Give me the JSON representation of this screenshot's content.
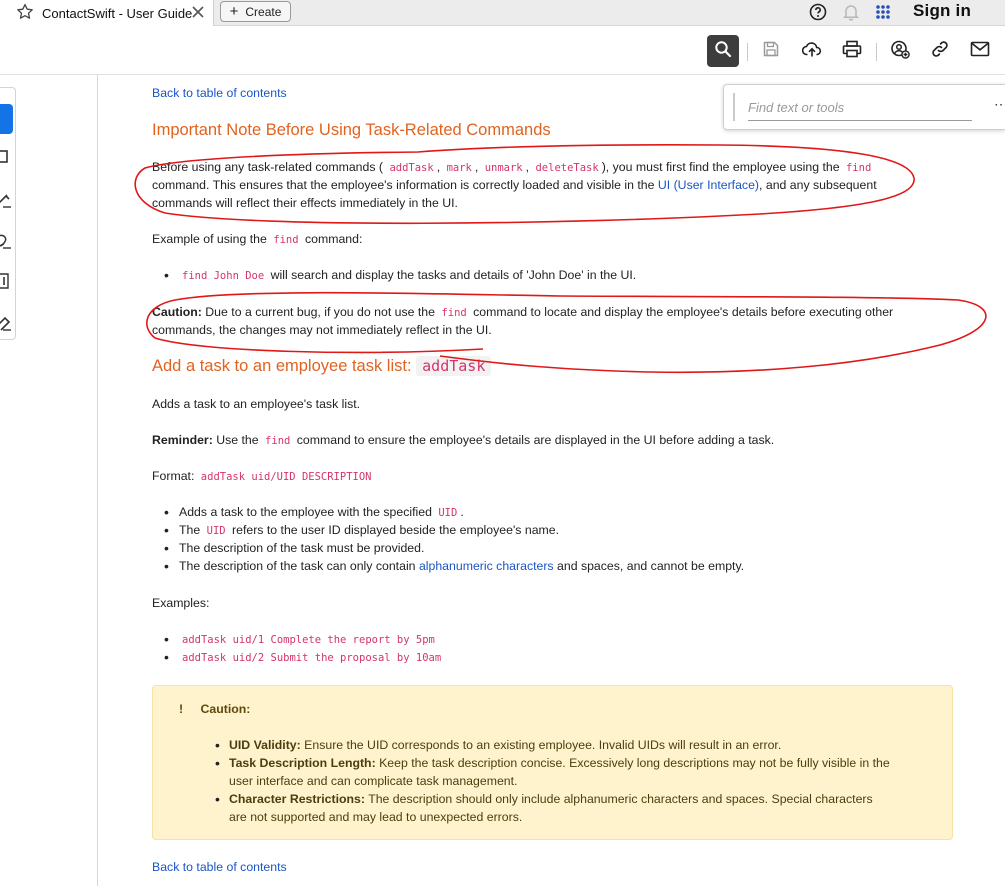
{
  "browser": {
    "tab_title": "ContactSwift - User Guide",
    "create_label": "Create",
    "signin_label": "Sign in"
  },
  "find": {
    "placeholder": "Find text or tools"
  },
  "doc": {
    "back_link_top": "Back to table of contents",
    "heading1": "Important Note Before Using Task-Related Commands",
    "para1": {
      "pre": "Before using any task-related commands (",
      "c1": "addTask",
      "sep1": ",",
      "c2": "mark",
      "sep2": ",",
      "c3": "unmark",
      "sep3": ",",
      "c4": "deleteTask",
      "mid": "), you must first find the employee using the",
      "c5": "find",
      "line2_pre": "command. This ensures that the employee's information is correctly loaded and visible in the",
      "line2_link": "UI (User Interface)",
      "line2_post": ", and any subsequent",
      "line3": "commands will reflect their effects immediately in the UI."
    },
    "example_intro_pre": "Example of using the",
    "example_intro_code": "find",
    "example_intro_post": "command:",
    "example_item_code": "find John Doe",
    "example_item_text": "will search and display the tasks and details of 'John Doe' in the UI.",
    "caution_label": "Caution:",
    "caution_pre": "Due to a current bug, if you do not use the",
    "caution_code": "find",
    "caution_post": "command to locate and display the employee's details before executing other",
    "caution_line2": "commands, the changes may not immediately reflect in the UI.",
    "heading2_text": "Add a task to an employee task list:",
    "heading2_code": "addTask",
    "adds_desc": "Adds a task to an employee's task list.",
    "reminder_label": "Reminder:",
    "reminder_pre": "Use the",
    "reminder_code": "find",
    "reminder_post": "command to ensure the employee's details are displayed in the UI before adding a task.",
    "format_label": "Format:",
    "format_code": "addTask uid/UID DESCRIPTION",
    "bullets": {
      "b1_pre": "Adds a task to the employee with the specified",
      "b1_code": "UID",
      "b1_post": ".",
      "b2_pre": "The",
      "b2_code": "UID",
      "b2_post": "refers to the user ID displayed beside the employee's name.",
      "b3": "The description of the task must be provided.",
      "b4_pre": "The description of the task can only contain",
      "b4_link": "alphanumeric characters",
      "b4_post": "and spaces, and cannot be empty."
    },
    "examples_label": "Examples:",
    "example1": "addTask uid/1 Complete the report by 5pm",
    "example2": "addTask uid/2 Submit the proposal by 10am",
    "caution_box": {
      "icon": "!",
      "title": "Caution:",
      "i1_label": "UID Validity:",
      "i1_text": "Ensure the UID corresponds to an existing employee. Invalid UIDs will result in an error.",
      "i2_label": "Task Description Length:",
      "i2_text": "Keep the task description concise. Excessively long descriptions may not be fully visible in the",
      "i2_line2": "user interface and can complicate task management.",
      "i3_label": "Character Restrictions:",
      "i3_text": "The description should only include alphanumeric characters and spaces. Special characters",
      "i3_line2": "are not supported and may lead to unexpected errors."
    },
    "back_link_bottom": "Back to table of contents"
  },
  "colors": {
    "heading": "#e06320",
    "link": "#1a55c4",
    "code": "#d6336c",
    "annotation": "#e01818",
    "caution_bg": "#fff3cd",
    "active_tool": "#1473e6"
  },
  "icons": [
    "star-icon",
    "close-icon",
    "plus-icon",
    "help-icon",
    "bell-icon",
    "apps-icon",
    "search-icon",
    "save-icon",
    "upload-icon",
    "print-icon",
    "share-icon",
    "link-icon",
    "email-icon",
    "more-icon"
  ]
}
